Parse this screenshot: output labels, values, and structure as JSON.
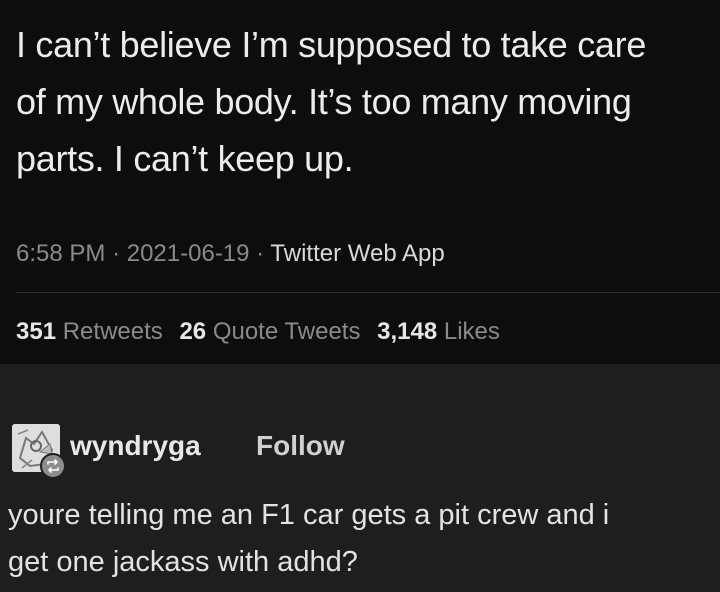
{
  "tweet": {
    "text": "I can’t believe I’m supposed to take care\nof my whole body. It’s too many moving\nparts. I can’t keep up.",
    "time": "6:58 PM",
    "separator": "·",
    "date": "2021-06-19",
    "app": "Twitter Web App",
    "stats": {
      "retweets_count": "351",
      "retweets_label": "Retweets",
      "quotes_count": "26",
      "quotes_label": "Quote Tweets",
      "likes_count": "3,148",
      "likes_label": "Likes"
    }
  },
  "post": {
    "username": "wyndryga",
    "follow_label": "Follow",
    "avatar_icon": "avatar-image",
    "badge_icon": "reblog-icon",
    "text": "youre telling me an F1 car gets a pit crew and i\nget one jackass with adhd?"
  }
}
